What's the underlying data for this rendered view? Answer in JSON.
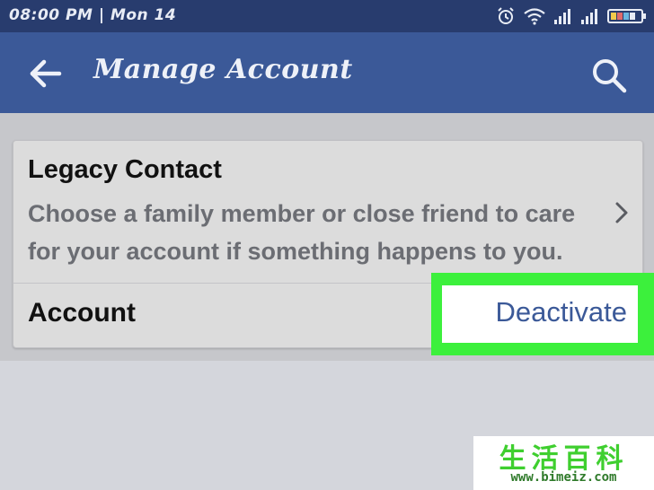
{
  "status_bar": {
    "time": "08:00 PM | Mon 14",
    "icons": [
      "alarm-icon",
      "wifi-icon",
      "signal-icon",
      "signal-icon",
      "battery-icon"
    ]
  },
  "header": {
    "title": "Manage Account",
    "back_icon": "arrow-left-icon",
    "search_icon": "search-icon",
    "color": "#3b5998"
  },
  "settings": {
    "legacy_contact": {
      "title": "Legacy Contact",
      "description": "Choose a family member or close friend to care for your account if something happens to you."
    },
    "account": {
      "label": "Account",
      "action_label": "Deactivate"
    }
  },
  "highlight_color": "#3cf03c",
  "watermark": {
    "chinese": "生活百科",
    "url": "www.bimeiz.com"
  }
}
